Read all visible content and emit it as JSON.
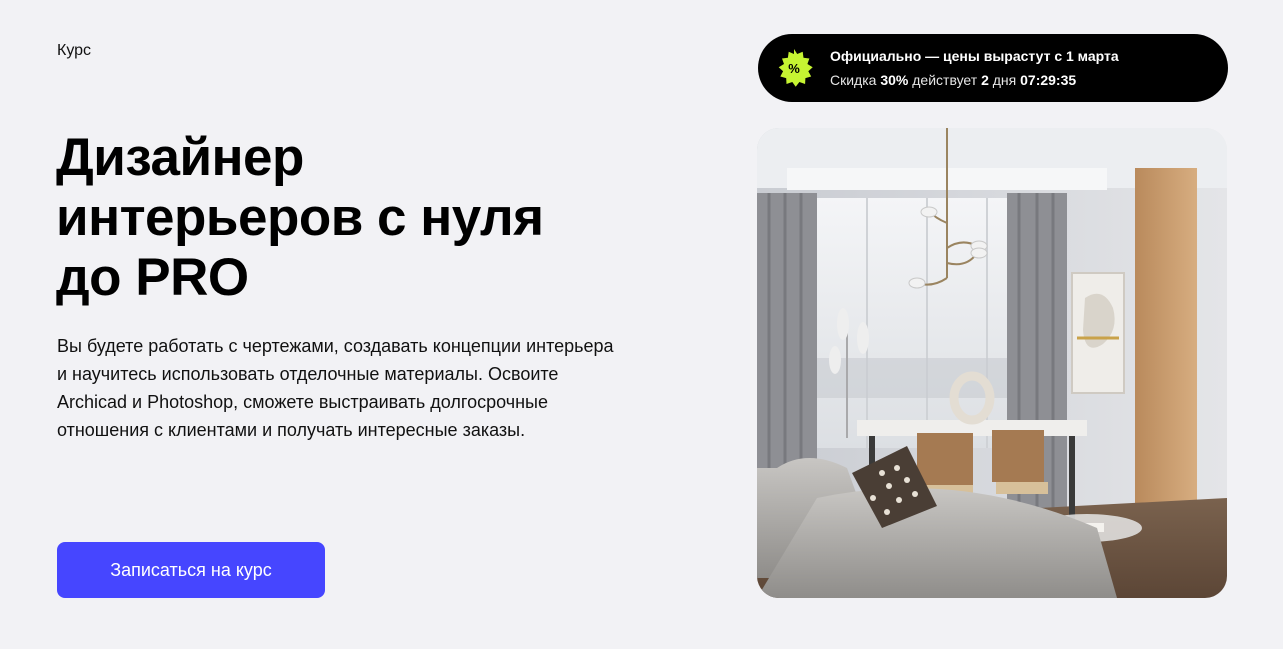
{
  "course": {
    "kicker": "Курс",
    "title_lines": [
      "Дизайнер",
      "интерьеров с нуля",
      "до PRO"
    ],
    "description": "Вы будете работать с чертежами, создавать концепции интерьера и научитесь использовать отделочные материалы. Освоите Archicad и Photoshop, сможете выстраивать долгосрочные отношения с клиентами и получать интересные заказы.",
    "cta_label": "Записаться на курс"
  },
  "promo": {
    "badge_symbol": "%",
    "headline": "Официально — цены вырастут с 1 марта",
    "discount_prefix": "Скидка",
    "discount_value": "30%",
    "discount_middle": "действует",
    "days_value": "2",
    "days_unit": "дня",
    "timer": "07:29:35"
  },
  "hero_image": {
    "alt": "Интерьер гостиной с диваном, столом, стульями и светильником"
  },
  "colors": {
    "background": "#f2f2f5",
    "accent": "#4646ff",
    "promo_bg": "#000000",
    "badge": "#c6f432"
  }
}
